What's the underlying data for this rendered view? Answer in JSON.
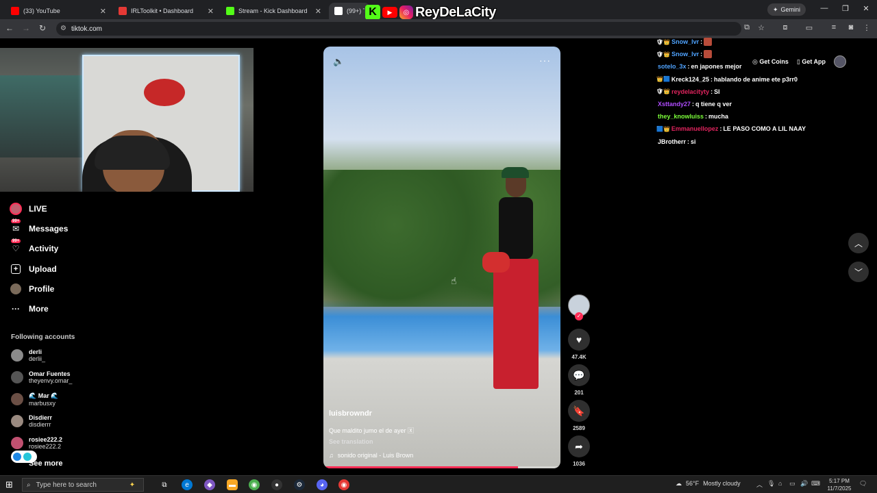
{
  "browser": {
    "tabs": [
      {
        "title": "(33) YouTube",
        "color": "#ff0000"
      },
      {
        "title": "IRLToolkit • Dashboard",
        "color": "#e53935"
      },
      {
        "title": "Stream - Kick Dashboard",
        "color": "#53fc18"
      },
      {
        "title": "(99+) Ti",
        "color": "#ffffff"
      }
    ],
    "gemini_label": "Gemini",
    "url": "tiktok.com"
  },
  "overlay": {
    "channel_name": "ReyDeLaCity"
  },
  "sidebar": {
    "items": [
      {
        "label": "LIVE",
        "icon": "live-icon"
      },
      {
        "label": "Messages",
        "icon": "messages-icon",
        "badge": "99+"
      },
      {
        "label": "Activity",
        "icon": "activity-icon",
        "badge": "99+"
      },
      {
        "label": "Upload",
        "icon": "upload-icon"
      },
      {
        "label": "Profile",
        "icon": "profile-icon"
      },
      {
        "label": "More",
        "icon": "more-icon"
      }
    ],
    "following_title": "Following accounts",
    "accounts": [
      {
        "name": "derli",
        "handle": "derlii_"
      },
      {
        "name": "Omar Fuentes",
        "handle": "theyenvy.omar_"
      },
      {
        "name": "🌊 Mar 🌊",
        "handle": "marbusxy"
      },
      {
        "name": "Disdierr",
        "handle": "disdierrr"
      },
      {
        "name": "rosiee222.2",
        "handle": "rosiee222.2"
      }
    ],
    "see_more": "See more"
  },
  "video": {
    "author": "luisbrowndr",
    "caption": "Que maldito jumo el de ayer 🅇",
    "see_translation": "See translation",
    "sound": "sonido original - Luis Brown",
    "progress": 0.82
  },
  "actions": {
    "likes": "47.4K",
    "comments": "201",
    "saves": "2589",
    "shares": "1036"
  },
  "topbar": {
    "get_coins": "Get Coins",
    "get_app": "Get App"
  },
  "chat": [
    {
      "badges": "🛡👑",
      "user": "Snow_lvr",
      "color": "#4fa3ff",
      "msg": "",
      "emote": true
    },
    {
      "badges": "🛡👑",
      "user": "Snow_lvr",
      "color": "#4fa3ff",
      "msg": "",
      "emote": true
    },
    {
      "badges": "",
      "user": "sotelo_3x",
      "color": "#4fa3ff",
      "msg": "en japones mejor",
      "emote": false
    },
    {
      "badges": "👑🟦",
      "user": "Kreck124_25",
      "color": "#ffffff",
      "msg": "hablando de anime ete p3rr0",
      "emote": false
    },
    {
      "badges": "🛡👑",
      "user": "reydelacityty",
      "color": "#e0245e",
      "msg": "SI",
      "emote": false
    },
    {
      "badges": "",
      "user": "Xsttandy27",
      "color": "#b04cff",
      "msg": "q tiene q ver",
      "emote": false
    },
    {
      "badges": "",
      "user": "they_knowluiss",
      "color": "#7cff3a",
      "msg": "mucha",
      "emote": false
    },
    {
      "badges": "🟦👑",
      "user": "Emmanuellopez",
      "color": "#e0245e",
      "msg": "LE PASO COMO A LIL NAAY",
      "emote": false
    },
    {
      "badges": "",
      "user": "JBrotherr",
      "color": "#ffffff",
      "msg": "si",
      "emote": false
    }
  ],
  "taskbar": {
    "search_placeholder": "Type here to search",
    "temperature": "56°F",
    "weather": "Mostly cloudy",
    "time": "5:17 PM",
    "date": "11/7/2025"
  }
}
